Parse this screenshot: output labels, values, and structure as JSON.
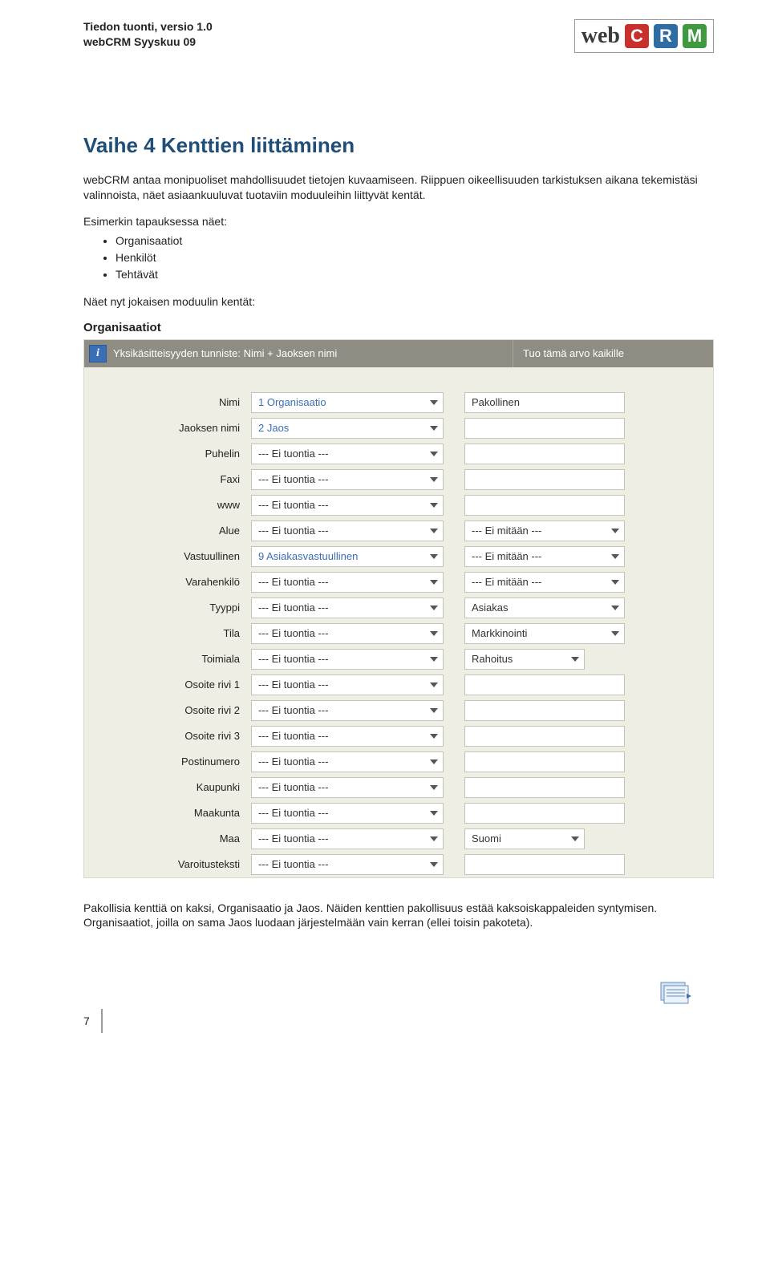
{
  "header": {
    "doc_title": "Tiedon tuonti, versio 1.0",
    "doc_sub": "webCRM Syyskuu 09",
    "logo_web": "web",
    "logo_c": "C",
    "logo_r": "R",
    "logo_m": "M"
  },
  "title": "Vaihe 4 Kenttien liittäminen",
  "intro": "webCRM antaa monipuoliset mahdollisuudet tietojen kuvaamiseen. Riippuen oikeellisuuden tarkistuksen aikana tekemistäsi valinnoista, näet asiaankuuluvat tuotaviin moduuleihin liittyvät kentät.",
  "example_lead": "Esimerkin tapauksessa näet:",
  "example_items": [
    "Organisaatiot",
    "Henkilöt",
    "Tehtävät"
  ],
  "see_now": "Näet nyt jokaisen moduulin kentät:",
  "section_heading": "Organisaatiot",
  "panel": {
    "info_glyph": "i",
    "header_left": "Yksikäsitteisyyden tunniste:  Nimi + Jaoksen nimi",
    "header_right": "Tuo tämä arvo kaikille",
    "rows": [
      {
        "label": "Nimi",
        "value": "1 Organisaatio",
        "value_link": true,
        "col2_type": "text",
        "col2": "Pakollinen"
      },
      {
        "label": "Jaoksen nimi",
        "value": "2 Jaos",
        "value_link": true,
        "col2_type": "text",
        "col2": ""
      },
      {
        "label": "Puhelin",
        "value": "--- Ei tuontia ---",
        "value_link": false,
        "col2_type": "text",
        "col2": ""
      },
      {
        "label": "Faxi",
        "value": "--- Ei tuontia ---",
        "value_link": false,
        "col2_type": "text",
        "col2": ""
      },
      {
        "label": "www",
        "value": "--- Ei tuontia ---",
        "value_link": false,
        "col2_type": "text",
        "col2": ""
      },
      {
        "label": "Alue",
        "value": "--- Ei tuontia ---",
        "value_link": false,
        "col2_type": "select",
        "col2": "--- Ei mitään ---"
      },
      {
        "label": "Vastuullinen",
        "value": "9 Asiakasvastuullinen",
        "value_link": true,
        "col2_type": "select",
        "col2": "--- Ei mitään ---"
      },
      {
        "label": "Varahenkilö",
        "value": "--- Ei tuontia ---",
        "value_link": false,
        "col2_type": "select",
        "col2": "--- Ei mitään ---"
      },
      {
        "label": "Tyyppi",
        "value": "--- Ei tuontia ---",
        "value_link": false,
        "col2_type": "select",
        "col2": "Asiakas"
      },
      {
        "label": "Tila",
        "value": "--- Ei tuontia ---",
        "value_link": false,
        "col2_type": "select",
        "col2": "Markkinointi"
      },
      {
        "label": "Toimiala",
        "value": "--- Ei tuontia ---",
        "value_link": false,
        "col2_type": "select_narrow",
        "col2": "Rahoitus"
      },
      {
        "label": "Osoite rivi 1",
        "value": "--- Ei tuontia ---",
        "value_link": false,
        "col2_type": "text",
        "col2": ""
      },
      {
        "label": "Osoite rivi 2",
        "value": "--- Ei tuontia ---",
        "value_link": false,
        "col2_type": "text",
        "col2": ""
      },
      {
        "label": "Osoite rivi 3",
        "value": "--- Ei tuontia ---",
        "value_link": false,
        "col2_type": "text",
        "col2": ""
      },
      {
        "label": "Postinumero",
        "value": "--- Ei tuontia ---",
        "value_link": false,
        "col2_type": "text",
        "col2": ""
      },
      {
        "label": "Kaupunki",
        "value": "--- Ei tuontia ---",
        "value_link": false,
        "col2_type": "text",
        "col2": ""
      },
      {
        "label": "Maakunta",
        "value": "--- Ei tuontia ---",
        "value_link": false,
        "col2_type": "text",
        "col2": ""
      },
      {
        "label": "Maa",
        "value": "--- Ei tuontia ---",
        "value_link": false,
        "col2_type": "select_narrow",
        "col2": "Suomi"
      },
      {
        "label": "Varoitusteksti",
        "value": "--- Ei tuontia ---",
        "value_link": false,
        "col2_type": "text",
        "col2": ""
      }
    ]
  },
  "bottom_paragraph": "Pakollisia kenttiä on kaksi, Organisaatio ja Jaos. Näiden kenttien pakollisuus estää kaksoiskappaleiden syntymisen. Organisaatiot, joilla on sama Jaos luodaan järjestelmään vain kerran (ellei toisin pakoteta).",
  "page_number": "7"
}
